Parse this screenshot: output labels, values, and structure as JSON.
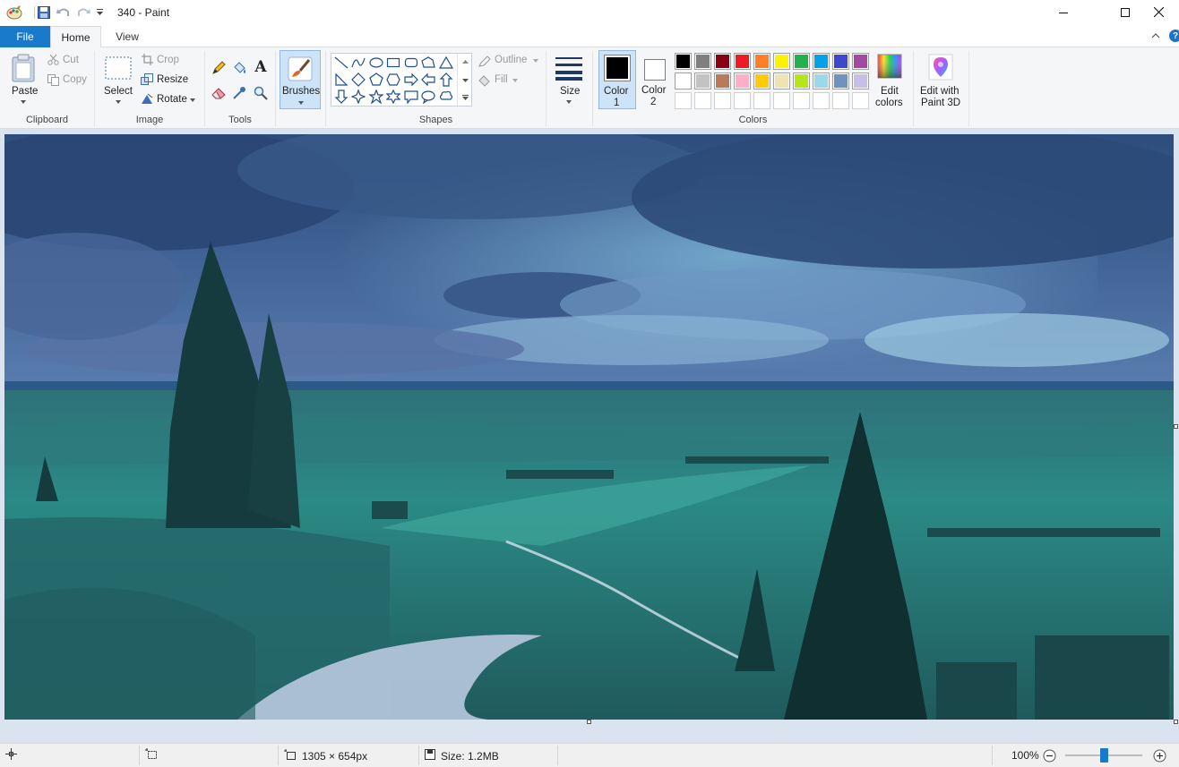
{
  "window": {
    "title": "340 - Paint",
    "minimize_icon": "minimize-icon",
    "maximize_icon": "maximize-icon",
    "close_icon": "close-icon"
  },
  "tabs": {
    "file": "File",
    "home": "Home",
    "view": "View"
  },
  "clipboard": {
    "paste": "Paste",
    "cut": "Cut",
    "copy": "Copy",
    "label": "Clipboard"
  },
  "image": {
    "select": "Select",
    "crop": "Crop",
    "resize": "Resize",
    "rotate": "Rotate",
    "label": "Image"
  },
  "tools": {
    "label": "Tools"
  },
  "brushes": {
    "label": "Brushes"
  },
  "shapes": {
    "outline": "Outline",
    "fill": "Fill",
    "label": "Shapes"
  },
  "size": {
    "label": "Size"
  },
  "colors": {
    "color1_label": "Color",
    "color1_num": "1",
    "color2_label": "Color",
    "color2_num": "2",
    "edit_colors_line1": "Edit",
    "edit_colors_line2": "colors",
    "label": "Colors",
    "color1_value": "#000000",
    "color2_value": "#ffffff",
    "palette_row1": [
      "#000000",
      "#7f7f7f",
      "#880015",
      "#ed1c24",
      "#ff7f27",
      "#fff200",
      "#22b14c",
      "#00a2e8",
      "#3f48cc",
      "#a349a4"
    ],
    "palette_row2": [
      "#ffffff",
      "#c3c3c3",
      "#b97a57",
      "#ffaec9",
      "#ffc90e",
      "#efe4b0",
      "#b5e61d",
      "#99d9ea",
      "#7092be",
      "#c8bfe7"
    ]
  },
  "paint3d": {
    "line1": "Edit with",
    "line2": "Paint 3D"
  },
  "status": {
    "dimensions": "1305 × 654px",
    "size": "Size: 1.2MB",
    "zoom": "100%",
    "zoom_fraction": 0.5
  }
}
